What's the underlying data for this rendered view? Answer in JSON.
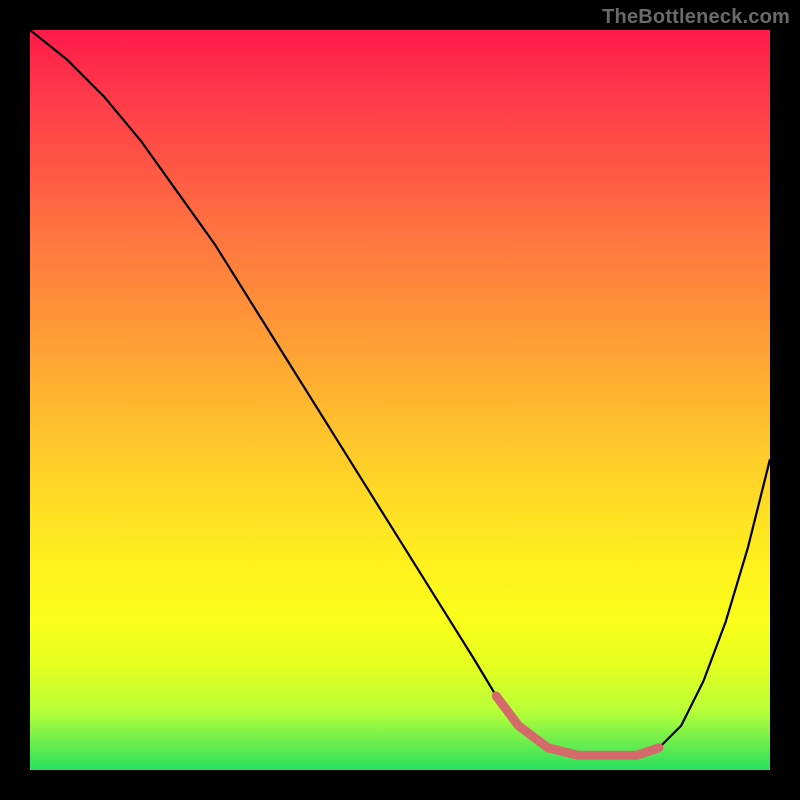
{
  "watermark": "TheBottleneck.com",
  "colors": {
    "background": "#000000",
    "curve": "#000000",
    "highlight": "#d46a6a"
  },
  "chart_data": {
    "type": "line",
    "title": "",
    "xlabel": "",
    "ylabel": "",
    "xlim": [
      0,
      100
    ],
    "ylim": [
      0,
      100
    ],
    "x": [
      0,
      5,
      10,
      15,
      20,
      25,
      30,
      35,
      40,
      45,
      50,
      55,
      60,
      63,
      66,
      70,
      74,
      78,
      82,
      85,
      88,
      91,
      94,
      97,
      100
    ],
    "values": [
      100,
      96,
      91,
      85,
      78,
      71,
      63,
      55,
      47,
      39,
      31,
      23,
      15,
      10,
      6,
      3,
      2,
      2,
      2,
      3,
      6,
      12,
      20,
      30,
      42
    ],
    "highlight_x_range": [
      63,
      85
    ],
    "notes": "Background is a vertical red→yellow→green gradient. Curve shows bottleneck % vs. an unlabeled x-axis; minimum (≈2%) lies roughly between x=63 and x=85, marked with a thick reddish overlay."
  }
}
